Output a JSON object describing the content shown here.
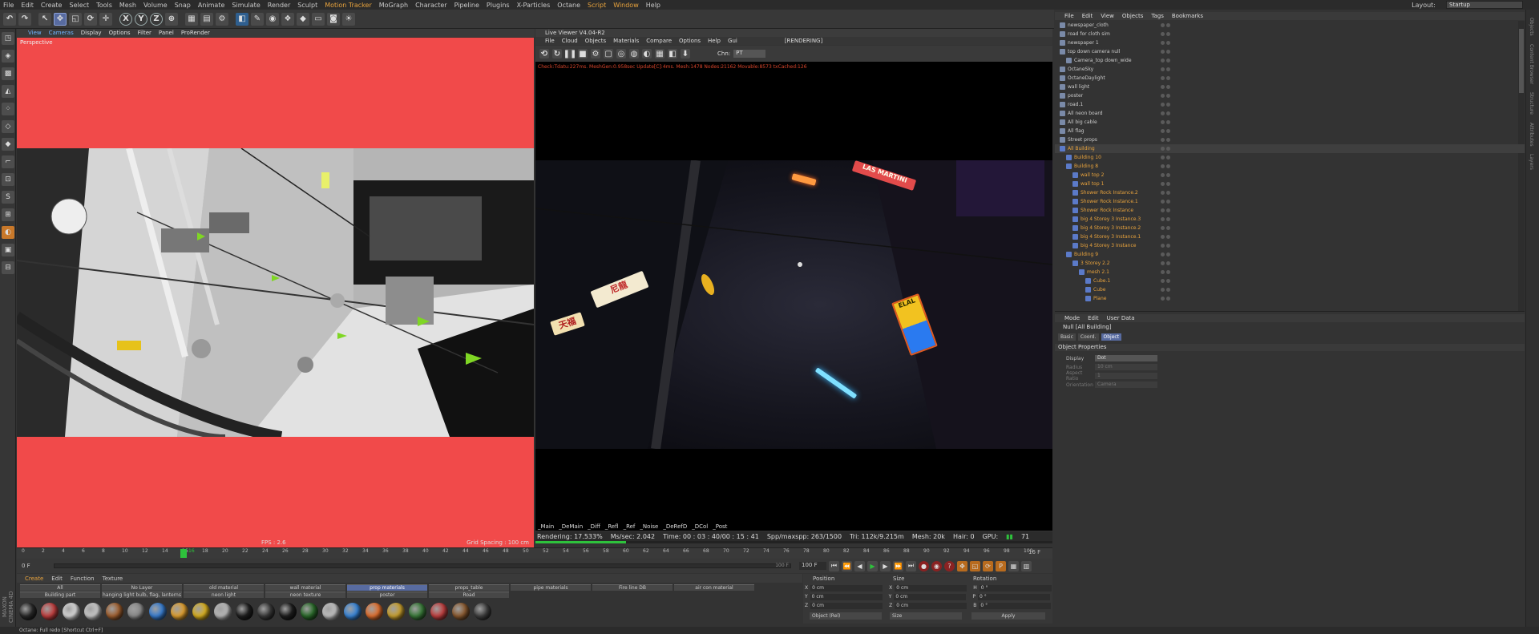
{
  "menubar": {
    "items": [
      "File",
      "Edit",
      "Create",
      "Select",
      "Tools",
      "Mesh",
      "Volume",
      "Snap",
      "Animate",
      "Simulate",
      "Render",
      "Sculpt",
      "Motion Tracker",
      "MoGraph",
      "Character",
      "Pipeline",
      "Plugins",
      "X-Particles",
      "Octane",
      "Script",
      "Window",
      "Help"
    ],
    "layout_label": "Layout:",
    "layout_value": "Startup"
  },
  "viewport": {
    "menu": [
      "View",
      "Cameras",
      "Display",
      "Options",
      "Filter",
      "Panel",
      "ProRender"
    ],
    "label": "Perspective",
    "fps": "FPS : 2.6",
    "grid_spacing": "Grid Spacing : 100 cm"
  },
  "live_viewer": {
    "title": "Live Viewer V4.04-R2",
    "menu": [
      "File",
      "Cloud",
      "Objects",
      "Materials",
      "Compare",
      "Options",
      "Help",
      "Gui"
    ],
    "rendering_label": "[RENDERING]",
    "channel_label": "Chn:",
    "channel_value": "PT",
    "stats_line": "Check:Tdatu:227ms. MeshGen:0.958sec Update[C]:4ms. Mesh:1478 Nodes:21162 Movable:8573 txCached:126",
    "passes": [
      "_Main",
      "_DeMain",
      "_Diff",
      "_Refl",
      "_Ref",
      "_Noise",
      "_DeRefD",
      "_DCol",
      "_Post"
    ],
    "status": {
      "rendering": "Rendering: 17.533%",
      "ms_sec": "Ms/sec: 2.042",
      "time": "Time: 00 : 03 : 40/00 : 15 : 41",
      "spp": "Spp/maxspp: 263/1500",
      "tri": "Tri: 112k/9.215m",
      "mesh": "Mesh: 20k",
      "hair": "Hair: 0",
      "gpu_label": "GPU:",
      "gpu_value": "71"
    },
    "progress": 0.175,
    "signs": [
      "天福",
      "LAS MARTINI",
      "尼龍",
      "ELAL"
    ]
  },
  "timeline": {
    "ticks": [
      "0",
      "2",
      "4",
      "6",
      "8",
      "10",
      "12",
      "14",
      "16",
      "18",
      "20",
      "22",
      "24",
      "26",
      "28",
      "30",
      "32",
      "34",
      "36",
      "38",
      "40",
      "42",
      "44",
      "46",
      "48",
      "50",
      "52",
      "54",
      "56",
      "58",
      "60",
      "62",
      "64",
      "66",
      "68",
      "70",
      "72",
      "74",
      "76",
      "78",
      "80",
      "82",
      "84",
      "86",
      "88",
      "90",
      "92",
      "94",
      "96",
      "98",
      "100"
    ],
    "current_frame": "16",
    "end_label": "16 F",
    "start_field": "0 F",
    "slider_label": "100 F",
    "end_field": "100 F"
  },
  "materials": {
    "menu": [
      "Create",
      "Edit",
      "Function",
      "Texture"
    ],
    "layers_row1": [
      "All",
      "No Layer",
      "old material",
      "wall material",
      "prop materials",
      "props_table",
      "pipe materials",
      "Fire line DB",
      "air con material"
    ],
    "layers_row2": [
      "Building part",
      "hanging light bulb, flag, lanterns",
      "neon light",
      "neon texture",
      "poster",
      "Road"
    ],
    "selected_layer": "prop materials",
    "swatch_colors": [
      "#2a2a2a",
      "#c24040",
      "#d8d8d8",
      "#c8c8c8",
      "#a06030",
      "#8a8a8a",
      "#3a7ed0",
      "#e0a030",
      "#d8b020",
      "#b8b8b8",
      "#202020",
      "#3a3a3a",
      "#1f1f1f",
      "#2a6a2a",
      "#c0c0c0",
      "#3a86d8",
      "#e07030",
      "#c8a030",
      "#3a7a3a",
      "#c04040",
      "#8a5a30",
      "#404040"
    ]
  },
  "coordinates": {
    "position_label": "Position",
    "size_label": "Size",
    "rotation_label": "Rotation",
    "rows": [
      {
        "axis": "X",
        "pos": "0 cm",
        "size": "0 cm",
        "rot_axis": "H",
        "rot": "0 °"
      },
      {
        "axis": "Y",
        "pos": "0 cm",
        "size": "0 cm",
        "rot_axis": "P",
        "rot": "0 °"
      },
      {
        "axis": "Z",
        "pos": "0 cm",
        "size": "0 cm",
        "rot_axis": "B",
        "rot": "0 °"
      }
    ],
    "mode_dropdown": "Object (Rel)",
    "size_dropdown": "Size",
    "apply_label": "Apply"
  },
  "objects_panel": {
    "menu": [
      "File",
      "Edit",
      "View",
      "Objects",
      "Tags",
      "Bookmarks"
    ],
    "rows": [
      {
        "name": "newspaper_cloth",
        "indent": 0,
        "color": "orange-none"
      },
      {
        "name": "road for cloth sim",
        "indent": 0
      },
      {
        "name": "newspaper 1",
        "indent": 0
      },
      {
        "name": "top down camera null",
        "indent": 0
      },
      {
        "name": "Camera_top down_wide",
        "indent": 1
      },
      {
        "name": "OctaneSky",
        "indent": 0
      },
      {
        "name": "OctaneDaylight",
        "indent": 0
      },
      {
        "name": "wall light",
        "indent": 0
      },
      {
        "name": "poster",
        "indent": 0
      },
      {
        "name": "road.1",
        "indent": 0
      },
      {
        "name": "All neon board",
        "indent": 0
      },
      {
        "name": "All big cable",
        "indent": 0
      },
      {
        "name": "All flag",
        "indent": 0
      },
      {
        "name": "Street props",
        "indent": 0
      },
      {
        "name": "All Building",
        "indent": 0,
        "orange": true,
        "selected": true
      },
      {
        "name": "Building 10",
        "indent": 1,
        "orange": true
      },
      {
        "name": "Building 8",
        "indent": 1,
        "orange": true
      },
      {
        "name": "wall top 2",
        "indent": 2,
        "orange": true
      },
      {
        "name": "wall top 1",
        "indent": 2,
        "orange": true
      },
      {
        "name": "Shower Rock Instance.2",
        "indent": 2,
        "orange": true
      },
      {
        "name": "Shower Rock Instance.1",
        "indent": 2,
        "orange": true
      },
      {
        "name": "Shower Rock Instance",
        "indent": 2,
        "orange": true
      },
      {
        "name": "big 4 Storey 3 Instance.3",
        "indent": 2,
        "orange": true
      },
      {
        "name": "big 4 Storey 3 Instance.2",
        "indent": 2,
        "orange": true
      },
      {
        "name": "big 4 Storey 3 Instance.1",
        "indent": 2,
        "orange": true
      },
      {
        "name": "big 4 Storey 3 Instance",
        "indent": 2,
        "orange": true
      },
      {
        "name": "Building 9",
        "indent": 1,
        "orange": true
      },
      {
        "name": "3 Storey 2.2",
        "indent": 2,
        "orange": true
      },
      {
        "name": "mesh 2.1",
        "indent": 3,
        "orange": true
      },
      {
        "name": "Cube.1",
        "indent": 4,
        "orange": true
      },
      {
        "name": "Cube",
        "indent": 4,
        "orange": true
      },
      {
        "name": "Plane",
        "indent": 4,
        "orange": true
      }
    ]
  },
  "attributes_panel": {
    "menu": [
      "Mode",
      "Edit",
      "User Data"
    ],
    "title": "Null [All Building]",
    "tabs": [
      "Basic",
      "Coord.",
      "Object"
    ],
    "active_tab": "Object",
    "section": "Object Properties",
    "props": [
      {
        "label": "Display",
        "value": "Dot",
        "dim": false
      },
      {
        "label": "Radius",
        "value": "10 cm",
        "dim": true
      },
      {
        "label": "Aspect Ratio",
        "value": "1",
        "dim": true
      },
      {
        "label": "Orientation",
        "value": "Camera",
        "dim": true
      }
    ]
  },
  "statusbar": {
    "text": "Octane:     Full redo [Shortcut Ctrl+F]"
  },
  "branding": {
    "maxon": "MAXON CINEMA 4D"
  },
  "right_strip": [
    "Objects",
    "Content Browser",
    "Structure",
    "Attributes",
    "Layers"
  ]
}
